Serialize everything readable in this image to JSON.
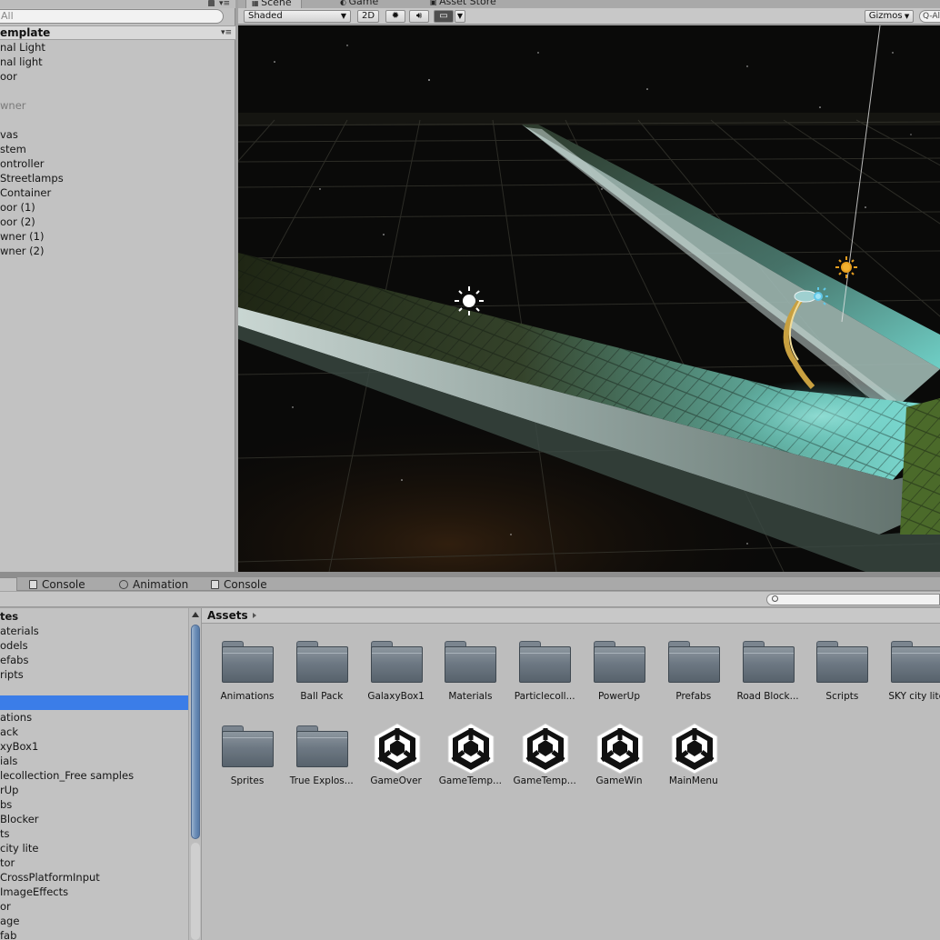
{
  "hierarchy": {
    "search_placeholder": "All",
    "lock_icon": "lock-icon",
    "scene_title": "emplate",
    "items": [
      {
        "label": "nal Light",
        "dim": false
      },
      {
        "label": "nal light",
        "dim": false
      },
      {
        "label": "oor",
        "dim": false
      },
      {
        "label": "",
        "dim": false
      },
      {
        "label": "wner",
        "dim": true
      },
      {
        "label": "",
        "dim": false
      },
      {
        "label": "vas",
        "dim": false
      },
      {
        "label": "stem",
        "dim": false
      },
      {
        "label": "ontroller",
        "dim": false
      },
      {
        "label": "Streetlamps",
        "dim": false
      },
      {
        "label": "Container",
        "dim": false
      },
      {
        "label": "oor (1)",
        "dim": false
      },
      {
        "label": "oor (2)",
        "dim": false
      },
      {
        "label": "wner (1)",
        "dim": false
      },
      {
        "label": "wner (2)",
        "dim": false
      }
    ]
  },
  "scene_view": {
    "tabs": [
      {
        "label": "Scene",
        "active": true
      },
      {
        "label": "Game",
        "active": false
      },
      {
        "label": "Asset Store",
        "active": false
      }
    ],
    "toolbar": {
      "shading_mode": "Shaded",
      "mode_2d": "2D",
      "lighting_icon": "sun-icon",
      "audio_icon": "speaker-icon",
      "effects_icon": "image-effects-icon",
      "gizmos": "Gizmos",
      "search_prefix": "Q-All"
    }
  },
  "bottom_tabs": [
    {
      "label": "Console",
      "icon": "console-icon"
    },
    {
      "label": "Animation",
      "icon": "clock-icon"
    },
    {
      "label": "Console",
      "icon": "console-icon"
    }
  ],
  "project": {
    "tree": [
      {
        "label": "tes",
        "bold": true,
        "selected": false
      },
      {
        "label": "aterials",
        "bold": false,
        "selected": false
      },
      {
        "label": "odels",
        "bold": false,
        "selected": false
      },
      {
        "label": "efabs",
        "bold": false,
        "selected": false
      },
      {
        "label": "ripts",
        "bold": false,
        "selected": false
      },
      {
        "label": "",
        "bold": false,
        "selected": false
      },
      {
        "label": "",
        "bold": false,
        "selected": true
      },
      {
        "label": "ations",
        "bold": false,
        "selected": false
      },
      {
        "label": "ack",
        "bold": false,
        "selected": false
      },
      {
        "label": "xyBox1",
        "bold": false,
        "selected": false
      },
      {
        "label": "ials",
        "bold": false,
        "selected": false
      },
      {
        "label": "lecollection_Free samples",
        "bold": false,
        "selected": false
      },
      {
        "label": "rUp",
        "bold": false,
        "selected": false
      },
      {
        "label": "bs",
        "bold": false,
        "selected": false
      },
      {
        "label": "Blocker",
        "bold": false,
        "selected": false
      },
      {
        "label": "ts",
        "bold": false,
        "selected": false
      },
      {
        "label": "city lite",
        "bold": false,
        "selected": false
      },
      {
        "label": "tor",
        "bold": false,
        "selected": false
      },
      {
        "label": "CrossPlatformInput",
        "bold": false,
        "selected": false
      },
      {
        "label": "ImageEffects",
        "bold": false,
        "selected": false
      },
      {
        "label": "or",
        "bold": false,
        "selected": false
      },
      {
        "label": "age",
        "bold": false,
        "selected": false
      },
      {
        "label": "fab",
        "bold": false,
        "selected": false
      }
    ],
    "breadcrumb": "Assets",
    "assets": [
      {
        "label": "Animations",
        "kind": "folder"
      },
      {
        "label": "Ball Pack",
        "kind": "folder"
      },
      {
        "label": "GalaxyBox1",
        "kind": "folder"
      },
      {
        "label": "Materials",
        "kind": "folder"
      },
      {
        "label": "Particlecoll...",
        "kind": "folder"
      },
      {
        "label": "PowerUp",
        "kind": "folder"
      },
      {
        "label": "Prefabs",
        "kind": "folder"
      },
      {
        "label": "Road Block...",
        "kind": "folder"
      },
      {
        "label": "Scripts",
        "kind": "folder"
      },
      {
        "label": "SKY city lite",
        "kind": "folder"
      },
      {
        "label": "Sprites",
        "kind": "folder"
      },
      {
        "label": "True Explos...",
        "kind": "folder"
      },
      {
        "label": "GameOver",
        "kind": "scene"
      },
      {
        "label": "GameTemp...",
        "kind": "scene"
      },
      {
        "label": "GameTemp...",
        "kind": "scene"
      },
      {
        "label": "GameWin",
        "kind": "scene"
      },
      {
        "label": "MainMenu",
        "kind": "scene"
      }
    ]
  }
}
